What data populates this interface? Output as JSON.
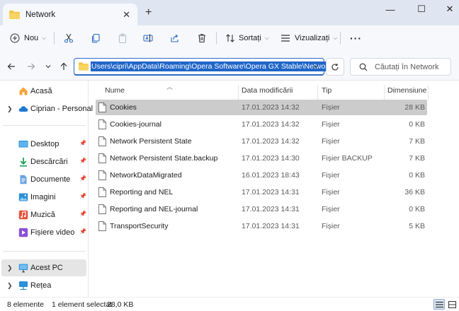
{
  "window": {
    "tab_title": "Network",
    "tab_close": "✕",
    "new_tab": "+",
    "minimize": "—",
    "maximize": "☐",
    "close": "✕"
  },
  "commands": {
    "new_label": "Nou",
    "sort_label": "Sortați",
    "view_label": "Vizualizați",
    "more_label": "···"
  },
  "address": {
    "path": "Users\\cipri\\AppData\\Roaming\\Opera Software\\Opera GX Stable\\Network"
  },
  "search": {
    "placeholder": "Căutați în Network"
  },
  "sidebar": {
    "items": [
      {
        "label": "Acasă",
        "icon": "home-icon"
      },
      {
        "label": "Ciprian - Personal",
        "icon": "onedrive-cloud-icon"
      },
      {
        "label": "Desktop",
        "icon": "desktop-icon"
      },
      {
        "label": "Descărcări",
        "icon": "download-icon"
      },
      {
        "label": "Documente",
        "icon": "documents-icon"
      },
      {
        "label": "Imagini",
        "icon": "pictures-icon"
      },
      {
        "label": "Muzică",
        "icon": "music-icon"
      },
      {
        "label": "Fișiere video",
        "icon": "videos-icon"
      },
      {
        "label": "Acest PC",
        "icon": "pc-icon"
      },
      {
        "label": "Rețea",
        "icon": "network-icon"
      }
    ]
  },
  "columns": {
    "name": "Nume",
    "date": "Data modificării",
    "type": "Tip",
    "size": "Dimensiune"
  },
  "files": [
    {
      "name": "Cookies",
      "date": "17.01.2023 14:32",
      "type": "Fișier",
      "size": "28 KB"
    },
    {
      "name": "Cookies-journal",
      "date": "17.01.2023 14:32",
      "type": "Fișier",
      "size": "0 KB"
    },
    {
      "name": "Network Persistent State",
      "date": "17.01.2023 14:32",
      "type": "Fișier",
      "size": "7 KB"
    },
    {
      "name": "Network Persistent State.backup",
      "date": "17.01.2023 14:30",
      "type": "Fișier BACKUP",
      "size": "7 KB"
    },
    {
      "name": "NetworkDataMigrated",
      "date": "16.01.2023 18:43",
      "type": "Fișier",
      "size": "0 KB"
    },
    {
      "name": "Reporting and NEL",
      "date": "17.01.2023 14:31",
      "type": "Fișier",
      "size": "36 KB"
    },
    {
      "name": "Reporting and NEL-journal",
      "date": "17.01.2023 14:31",
      "type": "Fișier",
      "size": "0 KB"
    },
    {
      "name": "TransportSecurity",
      "date": "17.01.2023 14:31",
      "type": "Fișier",
      "size": "5 KB"
    }
  ],
  "status": {
    "count": "8 elemente",
    "selection": "1 element selectat",
    "selection_size": "28,0 KB"
  },
  "colors": {
    "accent": "#2066c8",
    "folder": "#f4c542",
    "selected_row": "#cccccc"
  }
}
